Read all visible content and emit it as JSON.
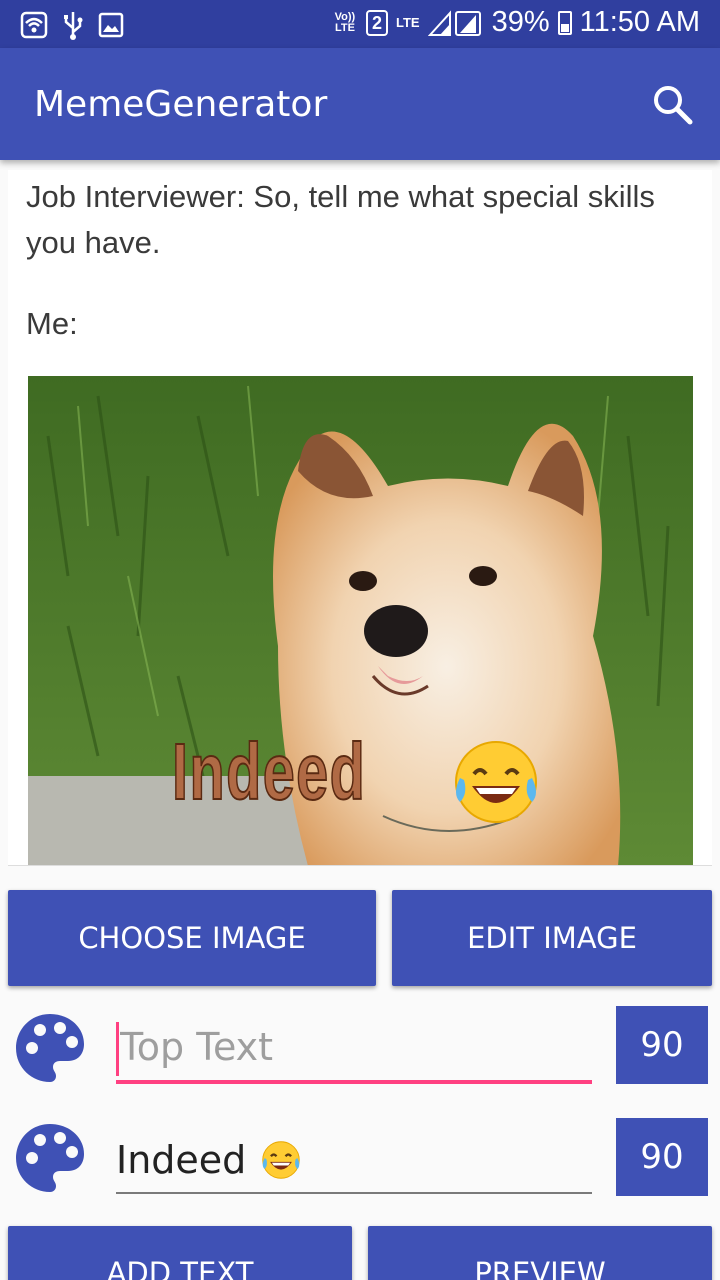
{
  "status_bar": {
    "icons": [
      "wifi-icon",
      "usb-icon",
      "image-icon",
      "volte-icon",
      "sim2-icon",
      "lte-icon",
      "signal-icon",
      "battery-icon"
    ],
    "volte": "Vo)) LTE",
    "sim": "2",
    "lte": "LTE",
    "battery": "39%",
    "time": "11:50 AM"
  },
  "appbar": {
    "title": "MemeGenerator",
    "search_icon": "search-icon",
    "color": "#3f51b5"
  },
  "meme": {
    "caption": "Job Interviewer: So, tell me what special skills you have.",
    "me_label": "Me:",
    "overlay_text": "Indeed",
    "overlay_emoji": "face-with-tears-of-joy"
  },
  "buttons": {
    "choose_image": "CHOOSE IMAGE",
    "edit_image": "EDIT IMAGE",
    "add_text": "ADD TEXT",
    "preview": "PREVIEW"
  },
  "text_rows": [
    {
      "placeholder": "Top Text",
      "value": "",
      "size": "90",
      "icon": "palette-icon"
    },
    {
      "placeholder": "",
      "value": "Indeed",
      "emoji": "face-with-tears-of-joy",
      "size": "90",
      "icon": "palette-icon"
    }
  ],
  "colors": {
    "primary": "#3f51b5",
    "primary_dark": "#303f9f",
    "accent": "#ff4081"
  }
}
